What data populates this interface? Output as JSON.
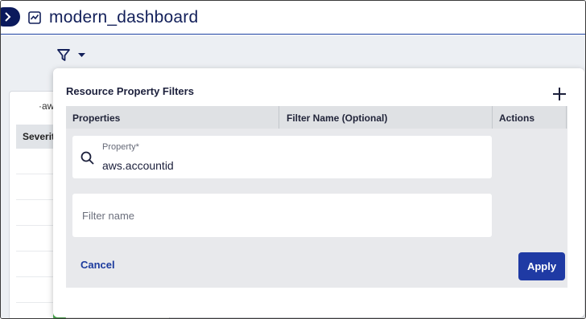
{
  "header": {
    "title": "modern_dashboard",
    "expand_icon": "chevron-right-icon",
    "dashboard_icon": "line-chart-icon"
  },
  "toolbar": {
    "filter_icon": "funnel-icon",
    "filter_caret_icon": "caret-down-icon"
  },
  "background_widget": {
    "title_partial": "·aw",
    "column_header_partial": "Severit",
    "rows": [
      {
        "status": "warning"
      },
      {
        "status": "warning"
      },
      {
        "status": "warning"
      },
      {
        "status": "warning"
      },
      {
        "status": "warning"
      },
      {
        "status": "warning"
      },
      {
        "status": "ok"
      }
    ]
  },
  "filter_panel": {
    "title": "Resource Property Filters",
    "add_icon": "plus-icon",
    "columns": [
      "Properties",
      "Filter Name (Optional)",
      "Actions"
    ],
    "property_field": {
      "label": "Property*",
      "value": "aws.accountid",
      "icon": "search-icon"
    },
    "filter_name_field": {
      "placeholder": "Filter name",
      "value": ""
    },
    "cancel_label": "Cancel",
    "apply_label": "Apply"
  },
  "colors": {
    "primary": "#1f3aa4",
    "header_text": "#13205a",
    "warning": "#f2c744",
    "ok": "#4caf50"
  }
}
